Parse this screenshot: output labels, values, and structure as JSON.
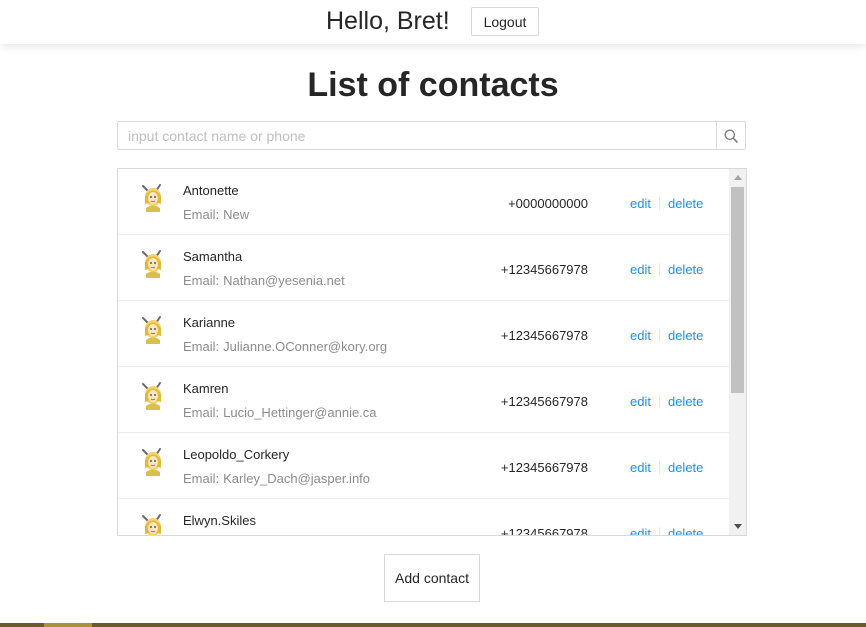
{
  "header": {
    "greeting": "Hello, Bret!",
    "logout_label": "Logout"
  },
  "page": {
    "title": "List of contacts"
  },
  "search": {
    "placeholder": "input contact name or phone",
    "value": "",
    "icon": "search-icon"
  },
  "contacts": {
    "email_prefix": "Email:",
    "edit_label": "edit",
    "delete_label": "delete",
    "items": [
      {
        "name": "Antonette",
        "email": "New",
        "phone": "+0000000000"
      },
      {
        "name": "Samantha",
        "email": "Nathan@yesenia.net",
        "phone": "+12345667978"
      },
      {
        "name": "Karianne",
        "email": "Julianne.OConner@kory.org",
        "phone": "+12345667978"
      },
      {
        "name": "Kamren",
        "email": "Lucio_Hettinger@annie.ca",
        "phone": "+12345667978"
      },
      {
        "name": "Leopoldo_Corkery",
        "email": "Karley_Dach@jasper.info",
        "phone": "+12345667978"
      },
      {
        "name": "Elwyn.Skiles",
        "email": "",
        "phone": "+12345667978"
      }
    ]
  },
  "actions": {
    "add_contact_label": "Add contact"
  },
  "colors": {
    "link": "#1890ff",
    "border": "#d9d9d9",
    "muted_text": "#8c8c8c",
    "footer": "#6b5a2a"
  }
}
